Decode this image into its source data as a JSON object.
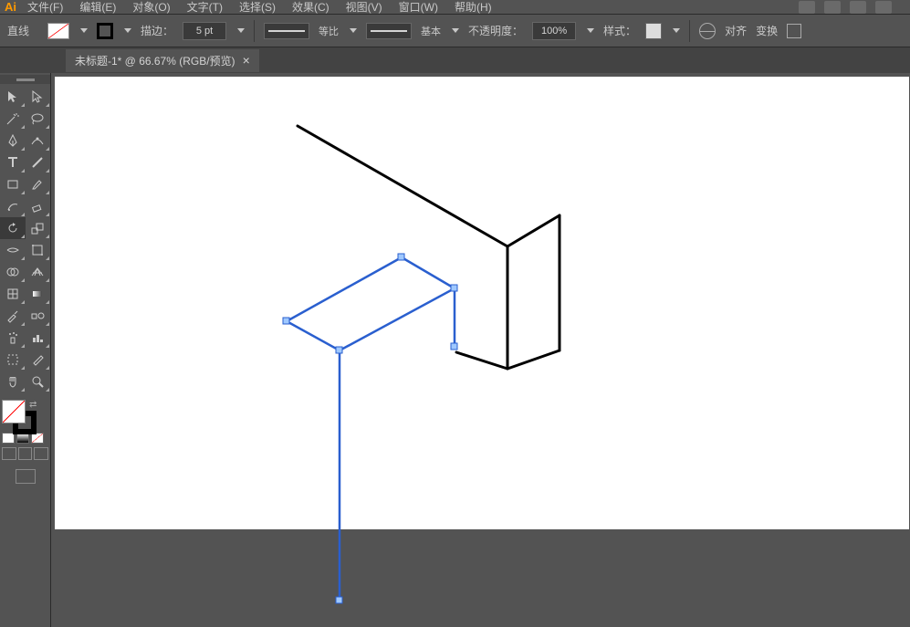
{
  "menu": {
    "items": [
      "文件(F)",
      "编辑(E)",
      "对象(O)",
      "文字(T)",
      "选择(S)",
      "效果(C)",
      "视图(V)",
      "窗口(W)",
      "帮助(H)"
    ]
  },
  "control": {
    "tool_label": "直线",
    "stroke_label": "描边：",
    "stroke_weight": "5 pt",
    "profile_label": "等比",
    "brush_label": "基本",
    "opacity_label": "不透明度：",
    "opacity_value": "100%",
    "style_label": "样式：",
    "align_label": "对齐",
    "transform_label": "变换"
  },
  "tab": {
    "title": "未标题-1* @ 66.67% (RGB/预览)"
  },
  "tools": {
    "rows": [
      [
        "selection-tool",
        "direct-selection-tool"
      ],
      [
        "magic-wand-tool",
        "lasso-tool"
      ],
      [
        "pen-tool",
        "curvature-tool"
      ],
      [
        "type-tool",
        "line-segment-tool"
      ],
      [
        "rectangle-tool",
        "paintbrush-tool"
      ],
      [
        "shaper-tool",
        "eraser-tool"
      ],
      [
        "rotate-tool",
        "scale-tool"
      ],
      [
        "width-tool",
        "free-transform-tool"
      ],
      [
        "shape-builder-tool",
        "perspective-grid-tool"
      ],
      [
        "mesh-tool",
        "gradient-tool"
      ],
      [
        "eyedropper-tool",
        "blend-tool"
      ],
      [
        "symbol-sprayer-tool",
        "column-graph-tool"
      ],
      [
        "artboard-tool",
        "slice-tool"
      ],
      [
        "hand-tool",
        "zoom-tool"
      ]
    ]
  }
}
